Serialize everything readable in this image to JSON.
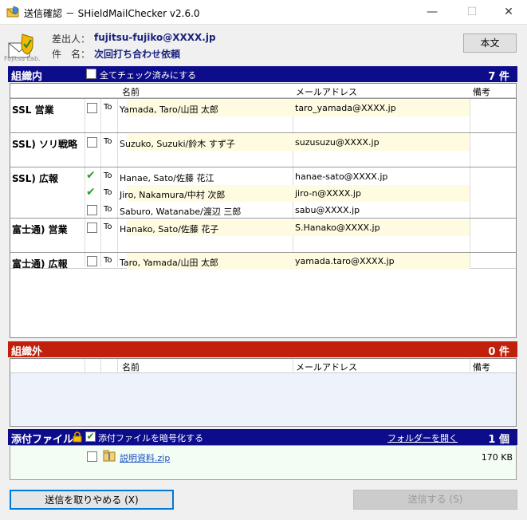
{
  "window": {
    "title": "送信確認 － SHieldMailChecker v2.6.0",
    "minimize_glyph": "—",
    "maximize_glyph": "☐",
    "close_glyph": "✕"
  },
  "header": {
    "logo_caption": "Fujitsu Lab.",
    "sender_label": "差出人：",
    "sender_value": "fujitsu-fujiko@XXXX.jp",
    "subject_label": "件　名：",
    "subject_value": "次回打ち合わせ依頼",
    "body_button": "本文"
  },
  "internal": {
    "title": "組織内",
    "check_all_label": "全てチェック済みにする",
    "count": "7 件",
    "columns": {
      "name": "名前",
      "email": "メールアドレス",
      "note": "備考"
    },
    "groups": [
      {
        "name": "SSL 営業",
        "rows": [
          {
            "checked": false,
            "type": "To",
            "name": "Yamada, Taro/山田 太郎",
            "email": "taro_yamada@XXXX.jp"
          }
        ]
      },
      {
        "name": "SSL) ソリ戦略",
        "rows": [
          {
            "checked": false,
            "type": "To",
            "name": "Suzuko, Suzuki/鈴木 すず子",
            "email": "suzusuzu@XXXX.jp"
          }
        ]
      },
      {
        "name": "SSL) 広報",
        "rows": [
          {
            "checked": true,
            "type": "To",
            "name": "Hanae, Sato/佐藤 花江",
            "email": "hanae-sato@XXXX.jp"
          },
          {
            "checked": true,
            "type": "To",
            "name": "Jiro, Nakamura/中村 次郎",
            "email": "jiro-n@XXXX.jp"
          },
          {
            "checked": false,
            "type": "To",
            "name": "Saburo, Watanabe/渡辺 三郎",
            "email": "sabu@XXXX.jp"
          }
        ]
      },
      {
        "name": "富士通) 営業",
        "rows": [
          {
            "checked": false,
            "type": "To",
            "name": "Hanako, Sato/佐藤 花子",
            "email": "S.Hanako@XXXX.jp"
          }
        ]
      },
      {
        "name": "富士通) 広報",
        "rows": [
          {
            "checked": false,
            "type": "To",
            "name": "Taro, Yamada/山田 太郎",
            "email": "yamada.taro@XXXX.jp"
          }
        ]
      }
    ]
  },
  "external": {
    "title": "組織外",
    "count": "0 件",
    "columns": {
      "name": "名前",
      "email": "メールアドレス",
      "note": "備考"
    }
  },
  "attachments": {
    "title": "添付ファイル",
    "encrypt_label": "添付ファイルを暗号化する",
    "encrypt_checked": true,
    "open_folder_link": "フォルダーを開く",
    "count": "1 個",
    "files": [
      {
        "checked": false,
        "name": "説明資料.zip",
        "size": "170 KB"
      }
    ]
  },
  "footer": {
    "cancel_button": "送信を取りやめる (X)",
    "send_button": "送信する (S)"
  },
  "colors": {
    "section_navy": "#0d0d8c",
    "section_red": "#c0200c",
    "row_highlight": "#fefbe0",
    "check_green": "#2aa02a",
    "link_blue": "#1a4fc2"
  }
}
